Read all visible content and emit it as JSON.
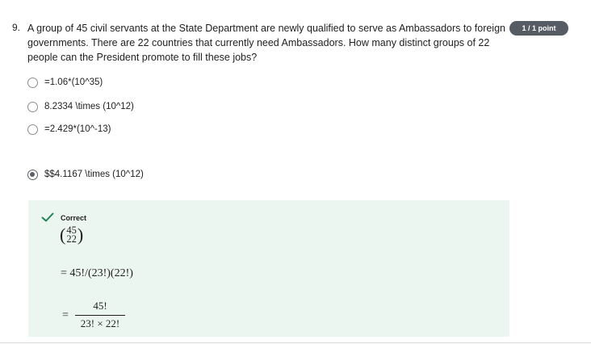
{
  "question": {
    "number": "9.",
    "text": "A group of 45 civil servants at the State Department are newly qualified to serve as Ambassadors to foreign governments. There are 22 countries that currently need Ambassadors. How many distinct groups of 22 people can the President promote to fill these jobs?",
    "score_badge": "1 / 1 point"
  },
  "options": [
    {
      "label": "=1.06*(10^35)",
      "selected": false
    },
    {
      "label": "8.2334 \\times (10^12)",
      "selected": false
    },
    {
      "label": "=2.429*(10^-13)",
      "selected": false
    },
    {
      "label": "$$4.1167 \\times (10^12)",
      "selected": true
    }
  ],
  "feedback": {
    "status": "Correct",
    "status_color": "#1f8354",
    "background": "#ecf6f1",
    "binom_top": "45",
    "binom_bottom": "22",
    "line2": "= 45!/(23!)(22!)",
    "eq_sign": "=",
    "frac_numerator": "45!",
    "frac_denominator": "23! × 22!"
  }
}
